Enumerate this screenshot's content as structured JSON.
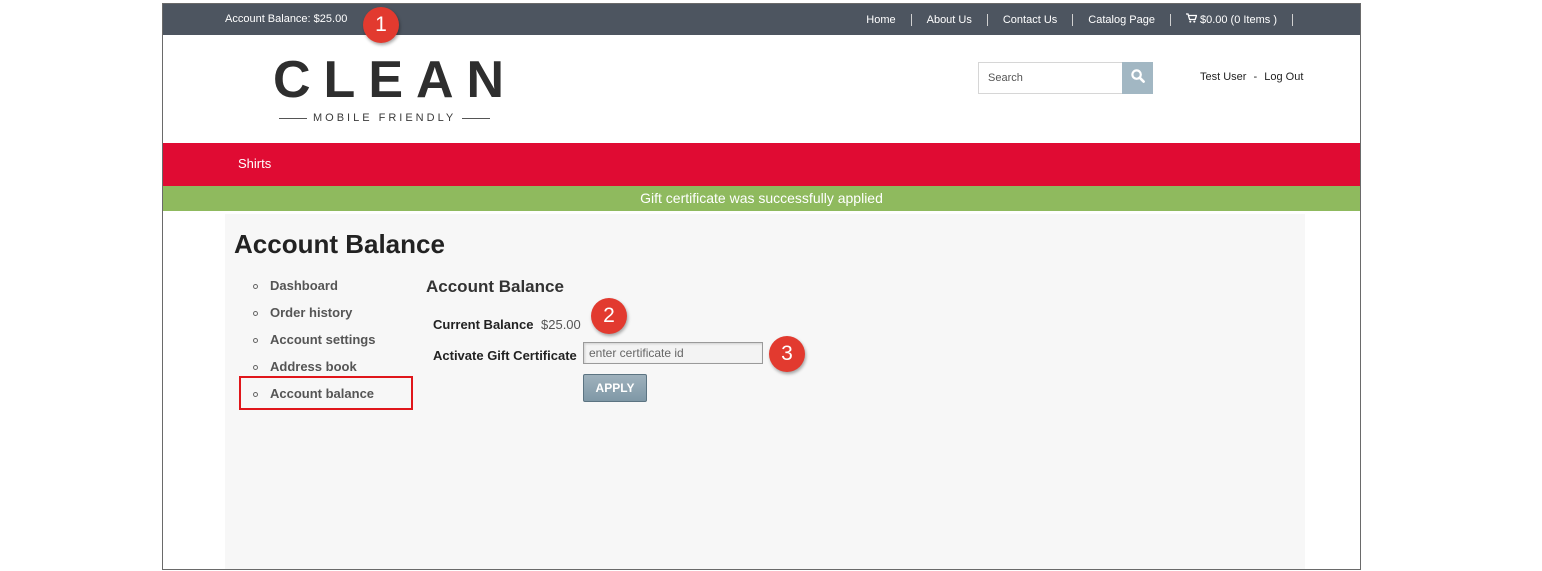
{
  "topbar": {
    "account_balance": "Account Balance: $25.00",
    "nav": [
      "Home",
      "About Us",
      "Contact Us",
      "Catalog Page"
    ],
    "cart": "$0.00 (0 Items )",
    "cart_icon": "shopping-cart-icon"
  },
  "header": {
    "logo_word": "CLEAN",
    "logo_tagline": "MOBILE FRIENDLY",
    "search_placeholder": "Search",
    "search_icon": "search-icon",
    "user_name": "Test User",
    "user_separator": "-",
    "logout": "Log Out"
  },
  "category_nav": {
    "items": [
      "Shirts"
    ],
    "color": "#e00b33"
  },
  "alert": {
    "message": "Gift certificate was successfully applied",
    "color": "#8fba5e"
  },
  "page": {
    "title": "Account Balance"
  },
  "sidebar": {
    "items": [
      {
        "label": "Dashboard"
      },
      {
        "label": "Order history"
      },
      {
        "label": "Account settings"
      },
      {
        "label": "Address book"
      },
      {
        "label": "Account balance"
      }
    ]
  },
  "main": {
    "section_title": "Account Balance",
    "current_balance_label": "Current Balance",
    "current_balance_value": "$25.00",
    "gift_label": "Activate Gift Certificate",
    "gift_placeholder": "enter certificate id",
    "apply_label": "APPLY"
  },
  "callouts": [
    "1",
    "2",
    "3"
  ]
}
